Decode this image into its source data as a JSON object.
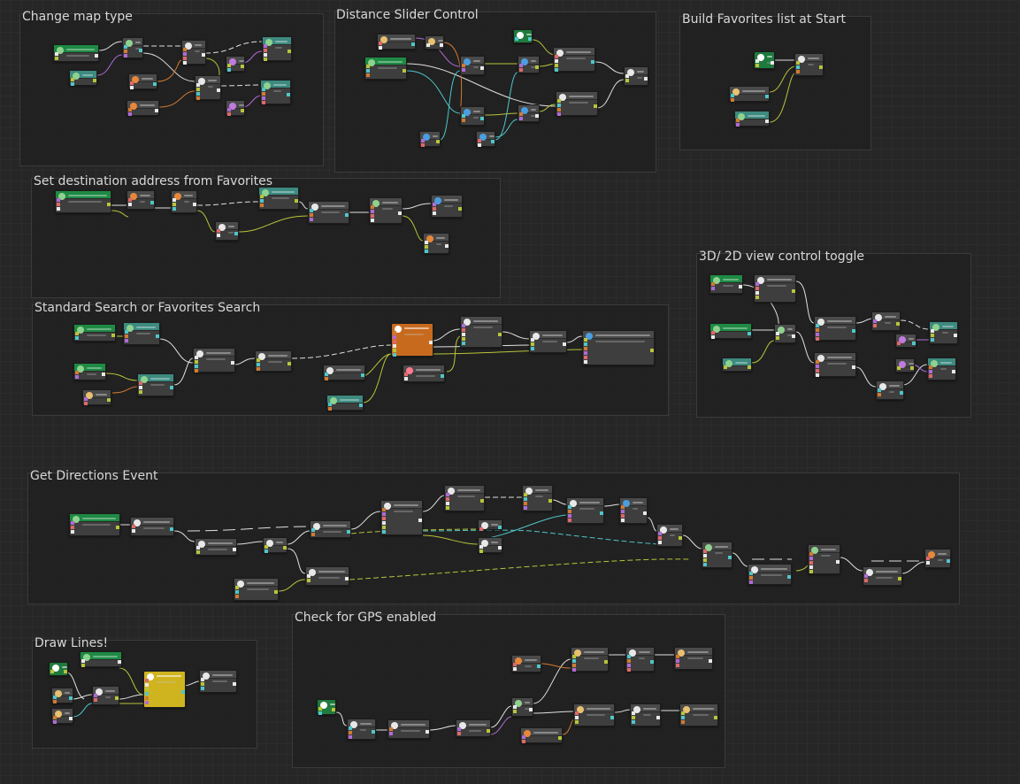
{
  "groups": [
    {
      "id": "g1",
      "title": "Change map type"
    },
    {
      "id": "g2",
      "title": "Distance Slider Control"
    },
    {
      "id": "g3",
      "title": "Build Favorites list at Start"
    },
    {
      "id": "g4",
      "title": "Set destination address from Favorites"
    },
    {
      "id": "g5",
      "title": "3D/ 2D view control toggle"
    },
    {
      "id": "g6",
      "title": "Standard Search or Favorites Search"
    },
    {
      "id": "g7",
      "title": "Get Directions Event"
    },
    {
      "id": "g8",
      "title": "Check for GPS enabled"
    },
    {
      "id": "g9",
      "title": "Draw Lines!"
    }
  ],
  "colors": {
    "event": "#1f7a3d",
    "variable": "#3a7f77",
    "function": "#3e3e3e",
    "highlight_orange": "#c76a1e",
    "highlight_yellow": "#cfb420",
    "wire_flow": "#e0e0e0",
    "wire_yellow": "#b8c43a",
    "wire_cyan": "#4fc6c9",
    "wire_orange": "#d27a30",
    "wire_purple": "#b06ad6"
  }
}
